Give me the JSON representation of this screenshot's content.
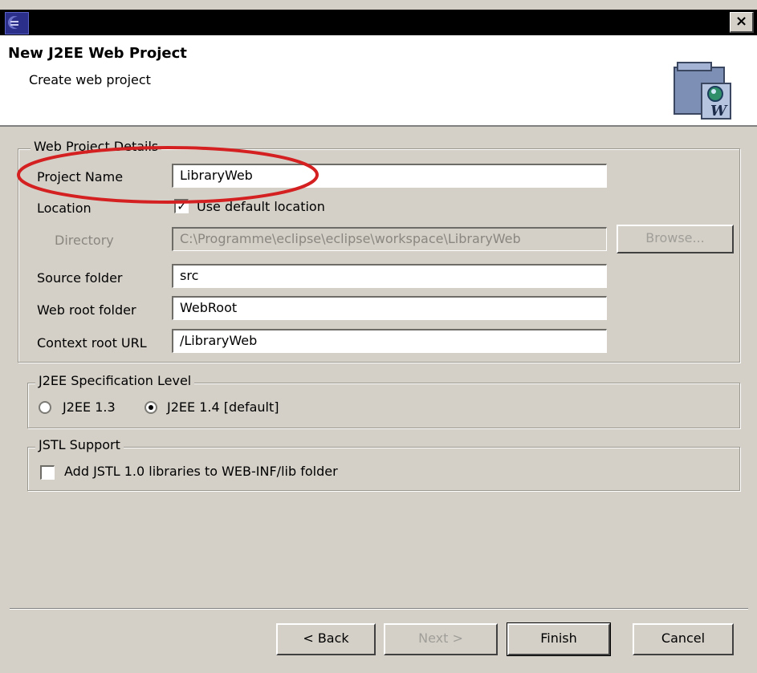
{
  "window": {
    "close_label": "×"
  },
  "header": {
    "title": "New J2EE Web Project",
    "subtitle": "Create web project"
  },
  "web_project_details": {
    "legend": "Web Project Details",
    "project_name": {
      "label": "Project Name",
      "value": "LibraryWeb"
    },
    "location": {
      "label": "Location",
      "checkbox_label": "Use default location",
      "checked": true
    },
    "directory": {
      "label": "Directory",
      "value": "C:\\Programme\\eclipse\\eclipse\\workspace\\LibraryWeb",
      "browse_label": "Browse..."
    },
    "source_folder": {
      "label": "Source folder",
      "value": "src"
    },
    "web_root_folder": {
      "label": "Web root folder",
      "value": "WebRoot"
    },
    "context_root_url": {
      "label": "Context root URL",
      "value": "/LibraryWeb"
    }
  },
  "spec_level": {
    "legend": "J2EE Specification Level",
    "options": [
      {
        "label": "J2EE 1.3",
        "selected": false
      },
      {
        "label": "J2EE 1.4 [default]",
        "selected": true
      }
    ]
  },
  "jstl": {
    "legend": "JSTL Support",
    "checkbox_label": "Add JSTL 1.0 libraries to WEB-INF/lib folder",
    "checked": false
  },
  "buttons": {
    "back": "< Back",
    "next": "Next >",
    "finish": "Finish",
    "cancel": "Cancel"
  },
  "colors": {
    "annotation": "#d42020",
    "dialog_bg": "#d4d0c8"
  }
}
